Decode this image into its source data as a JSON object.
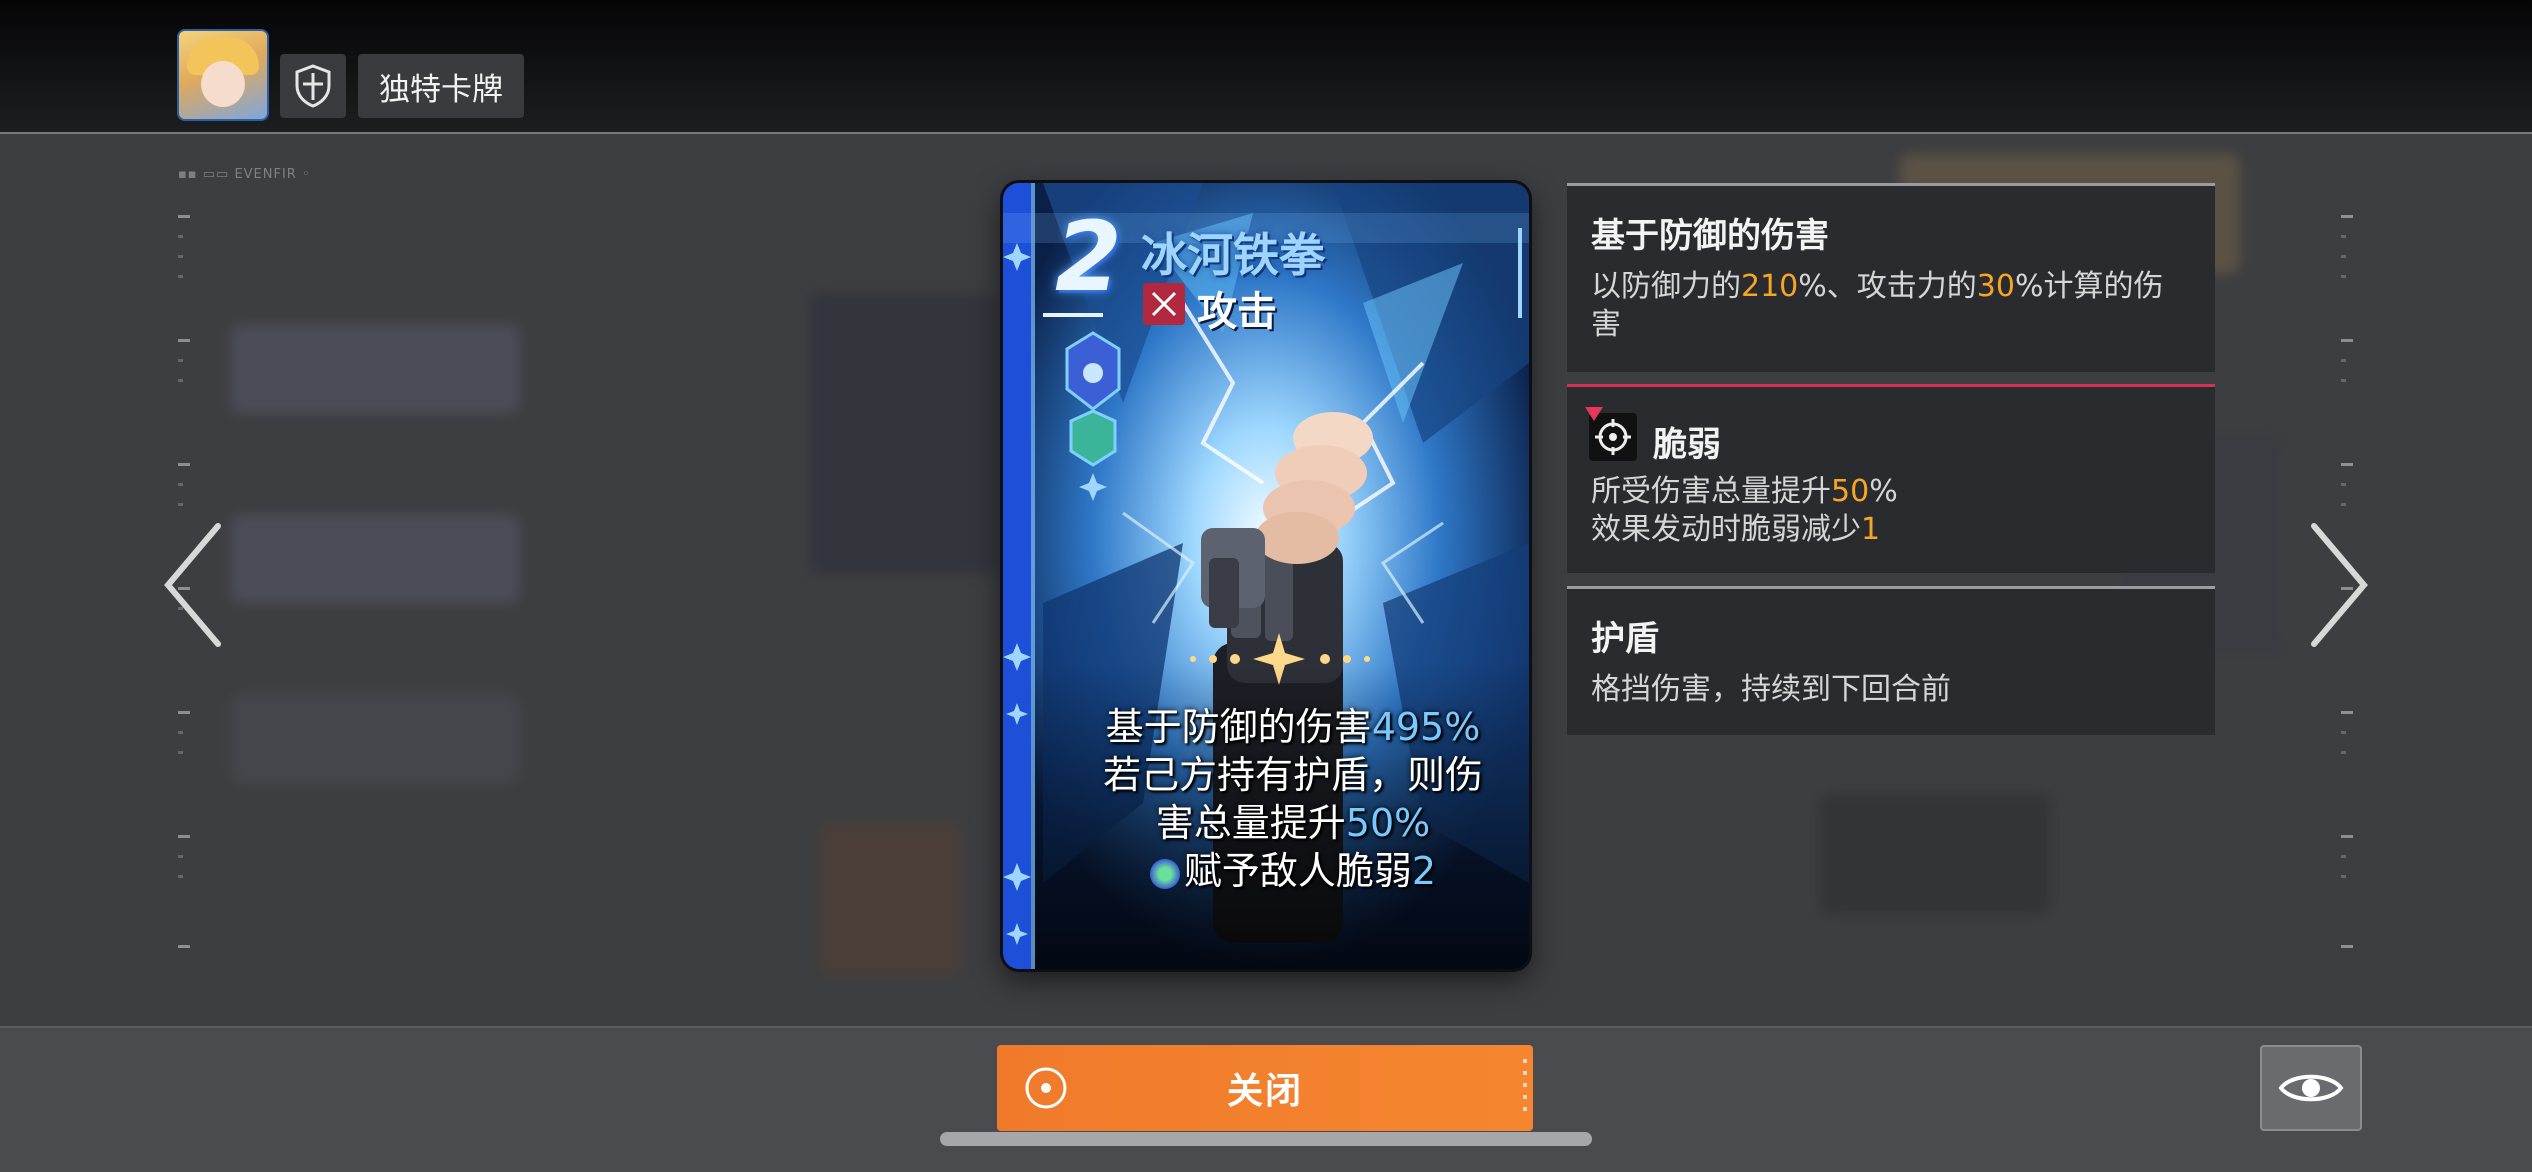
{
  "header": {
    "tab_label": "独特卡牌"
  },
  "branding": {
    "strip_text": "EVENFIR"
  },
  "card": {
    "cost": "2",
    "name": "冰河铁拳",
    "type": "攻击",
    "description": {
      "line1_prefix": "基于防御的伤害",
      "line1_value": "495",
      "line1_suffix": "%",
      "line2": "若己方持有护盾，则伤",
      "line3_prefix": "害总量提升",
      "line3_value": "50",
      "line3_suffix": "%",
      "line4_prefix": "赋予敌人脆弱",
      "line4_value": "2"
    },
    "colors": {
      "frame": "#1e4fd8",
      "name": "#9fd4ff",
      "highlight": "#79c8ff"
    }
  },
  "keywords": [
    {
      "title": "基于防御的伤害",
      "desc": {
        "p1": "以防御力的",
        "v1": "210",
        "p2": "%、攻击力的",
        "v2": "30",
        "p3": "%计算的伤",
        "p4": "害"
      }
    },
    {
      "title": "脆弱",
      "icon": "crosshair-icon",
      "desc": {
        "p1": "所受伤害总量提升",
        "v1": "50",
        "p2": "%",
        "p3": "效果发动时脆弱减少",
        "v3": "1"
      }
    },
    {
      "title": "护盾",
      "desc": {
        "p1": "格挡伤害，持续到下回合前"
      }
    }
  ],
  "footer": {
    "close_label": "关闭"
  },
  "colors": {
    "accent_orange": "#f5862f",
    "highlight_orange": "#f6a623",
    "vuln_red": "#d4334d"
  }
}
